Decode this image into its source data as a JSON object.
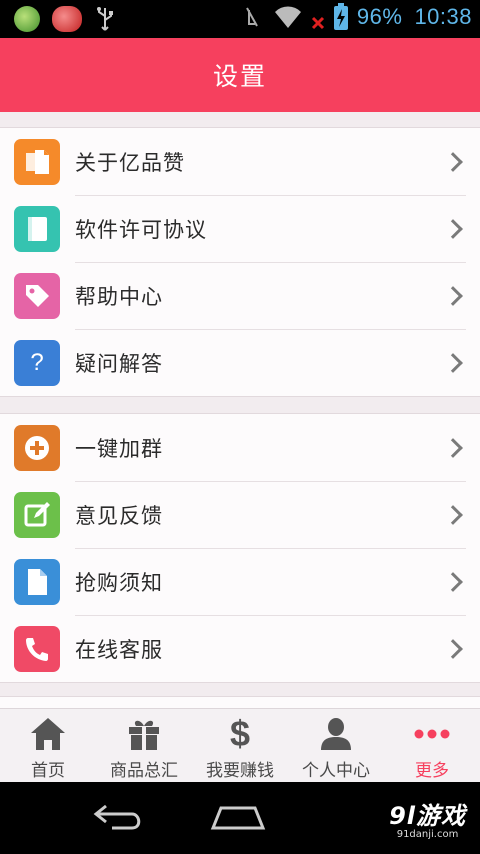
{
  "status_bar": {
    "battery_percent": "96%",
    "time": "10:38"
  },
  "header": {
    "title": "设置"
  },
  "groups": [
    {
      "items": [
        {
          "label": "关于亿品赞",
          "icon": "copy-documents-icon",
          "color": "#f58a2a"
        },
        {
          "label": "软件许可协议",
          "icon": "book-icon",
          "color": "#35c3b0"
        },
        {
          "label": "帮助中心",
          "icon": "tag-icon",
          "color": "#e564a6"
        },
        {
          "label": "疑问解答",
          "icon": "question-icon",
          "color": "#3a7fd6"
        }
      ]
    },
    {
      "items": [
        {
          "label": "一键加群",
          "icon": "plus-circle-icon",
          "color": "#e07a2a"
        },
        {
          "label": "意见反馈",
          "icon": "edit-icon",
          "color": "#6cc04a"
        },
        {
          "label": "抢购须知",
          "icon": "document-icon",
          "color": "#3a8fd8"
        },
        {
          "label": "在线客服",
          "icon": "phone-icon",
          "color": "#f04a66"
        }
      ]
    }
  ],
  "tabbar": {
    "tabs": [
      {
        "label": "首页",
        "icon": "home-icon"
      },
      {
        "label": "商品总汇",
        "icon": "gift-icon"
      },
      {
        "label": "我要赚钱",
        "icon": "dollar-icon"
      },
      {
        "label": "个人中心",
        "icon": "person-icon"
      },
      {
        "label": "更多",
        "icon": "more-dots-icon",
        "active": true
      }
    ]
  },
  "watermark": {
    "brand": "9l游戏",
    "domain": "91danji.com"
  },
  "colors": {
    "accent": "#f6405e"
  }
}
